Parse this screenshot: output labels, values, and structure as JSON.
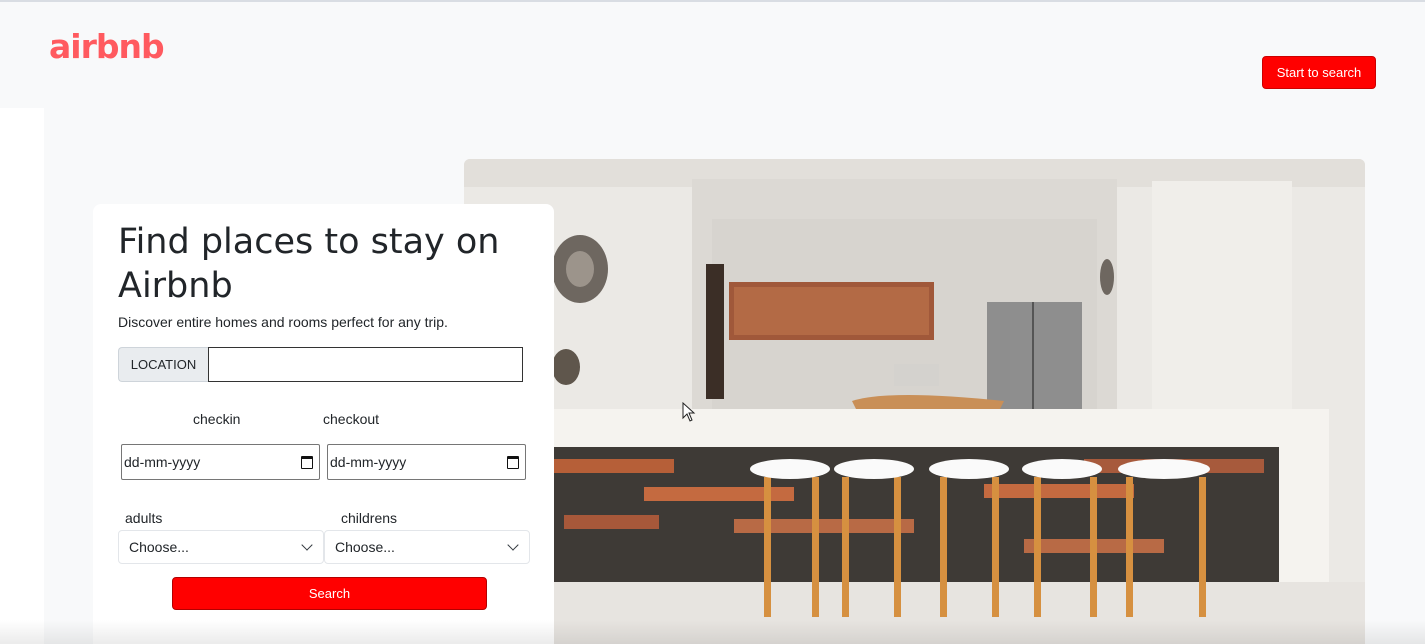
{
  "header": {
    "logo_text": "airbnb",
    "start_button_label": "Start to search"
  },
  "hero": {
    "title": "Find places to stay on Airbnb",
    "subtitle": "Discover entire homes and rooms perfect for any trip."
  },
  "form": {
    "location_label": "LOCATION",
    "location_value": "",
    "checkin_label": "checkin",
    "checkout_label": "checkout",
    "checkin_value": "dd-mm-yyyy",
    "checkout_value": "dd-mm-yyyy",
    "adults_label": "adults",
    "childrens_label": "childrens",
    "adults_selected": "Choose...",
    "childrens_selected": "Choose...",
    "search_label": "Search"
  },
  "colors": {
    "brand": "#ff5a5f",
    "button_red": "#ff0000",
    "header_bg": "#f8f9fa"
  },
  "icons": [
    "airbnb-logo-icon",
    "calendar-icon",
    "chevron-down-icon"
  ]
}
